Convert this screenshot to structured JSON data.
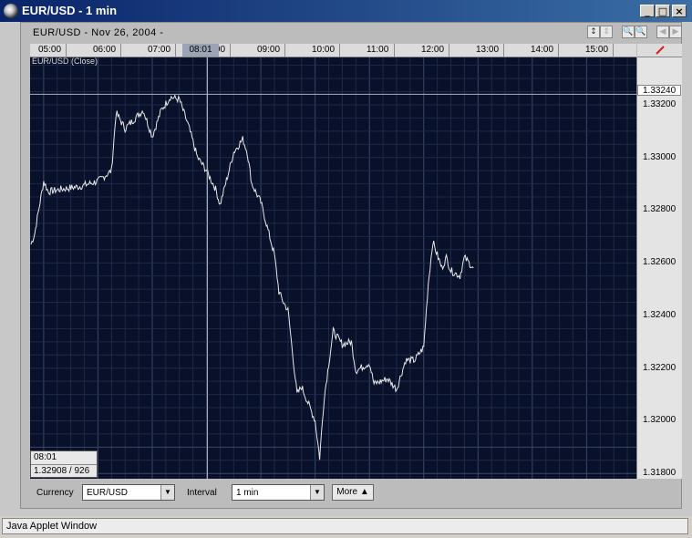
{
  "window": {
    "title": "EUR/USD - 1 min",
    "minimize": "_",
    "maximize": "□",
    "close": "×"
  },
  "chart_header": {
    "title": "EUR/USD - Nov 26, 2004 -"
  },
  "toolbar": {
    "up_down": "↕",
    "up_down2": "⇕",
    "zoom_in": "🔍",
    "zoom_out": "🔍",
    "scroll_left": "◀",
    "scroll_right": "▶"
  },
  "time_axis": [
    "05:00",
    "06:00",
    "07:00",
    "08:00",
    "09:00",
    "10:00",
    "11:00",
    "12:00",
    "13:00",
    "14:00",
    "15:00"
  ],
  "cursor_time": "08:01",
  "series_label": "EUR/USD (Close)",
  "y_axis": [
    "1.33200",
    "1.33000",
    "1.32800",
    "1.32600",
    "1.32400",
    "1.32200",
    "1.32000",
    "1.31800"
  ],
  "y_cursor": "1.33240",
  "readout": {
    "time": "08:01",
    "value": "1.32908 / 926"
  },
  "controls": {
    "currency_label": "Currency",
    "currency_value": "EUR/USD",
    "interval_label": "Interval",
    "interval_value": "1 min",
    "more_label": "More ▲"
  },
  "status": "Java Applet Window",
  "colors": {
    "plot_bg": "#08102a",
    "grid": "#2c3a5a",
    "line": "#e8e8e8",
    "title_bar": "#0a246a"
  },
  "chart_data": {
    "type": "line",
    "title": "EUR/USD (Close)",
    "xlabel": "",
    "ylabel": "",
    "ylim": [
      1.3178,
      1.3338
    ],
    "xlim": [
      "04:45",
      "15:55"
    ],
    "grid": true,
    "x": [
      "04:46",
      "04:50",
      "05:00",
      "05:05",
      "05:20",
      "05:40",
      "06:00",
      "06:15",
      "06:20",
      "06:30",
      "06:50",
      "07:00",
      "07:10",
      "07:20",
      "07:30",
      "07:40",
      "07:50",
      "08:00",
      "08:10",
      "08:15",
      "08:30",
      "08:40",
      "08:45",
      "08:50",
      "09:00",
      "09:15",
      "09:20",
      "09:25",
      "09:30",
      "09:40",
      "09:45",
      "10:00",
      "10:05",
      "10:10",
      "10:20",
      "10:30",
      "10:40",
      "10:45",
      "11:00",
      "11:05",
      "11:20",
      "11:30",
      "11:40",
      "11:50",
      "12:00",
      "12:05",
      "12:10",
      "12:20",
      "12:25",
      "12:30",
      "12:40",
      "12:45",
      "12:55"
    ],
    "series": [
      {
        "values": [
          1.3267,
          1.3271,
          1.3291,
          1.3287,
          1.3288,
          1.3289,
          1.3291,
          1.3295,
          1.3317,
          1.3311,
          1.3318,
          1.3308,
          1.3318,
          1.3323,
          1.3322,
          1.3312,
          1.33,
          1.3295,
          1.3288,
          1.3282,
          1.3302,
          1.3307,
          1.3302,
          1.329,
          1.3283,
          1.3263,
          1.3249,
          1.3245,
          1.3242,
          1.321,
          1.3213,
          1.32,
          1.3186,
          1.3209,
          1.3234,
          1.3229,
          1.323,
          1.3219,
          1.3222,
          1.3214,
          1.3216,
          1.3212,
          1.3223,
          1.3223,
          1.3228,
          1.3252,
          1.3268,
          1.3258,
          1.3262,
          1.3257,
          1.3255,
          1.3262,
          1.3258
        ]
      }
    ]
  }
}
